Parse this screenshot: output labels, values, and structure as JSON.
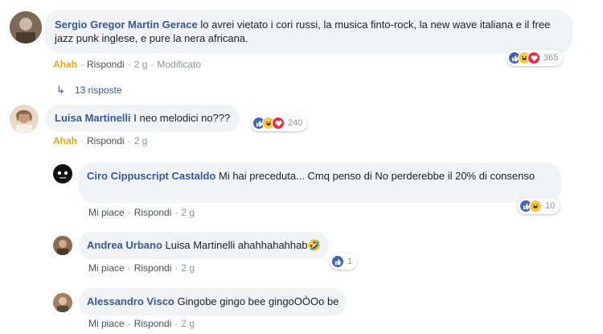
{
  "comments": [
    {
      "author": "Sergio Gregor Martin Gerace",
      "text": "lo avrei vietato i cori russi, la musica finto-rock, la new wave italiana e il free jazz punk inglese, e pure la nera africana.",
      "actions": {
        "react": "Ahah",
        "reply": "Rispondi",
        "time": "2 g",
        "edited": "Modificato"
      },
      "reaction_count": "365",
      "reactions": [
        "like-icon",
        "haha-icon",
        "love-icon"
      ]
    },
    {
      "author": "Luisa Martinelli",
      "text": "I neo melodici no???",
      "actions": {
        "react": "Ahah",
        "reply": "Rispondi",
        "time": "2 g"
      },
      "reaction_count": "240",
      "reactions": [
        "like-icon",
        "haha-icon",
        "love-icon"
      ]
    }
  ],
  "replies_link": {
    "label": "13 risposte"
  },
  "replies": [
    {
      "author": "Ciro Cippuscript Castaldo",
      "text": "Mi hai preceduta... Cmq penso di No perderebbe il 20% di consenso",
      "actions": {
        "like": "Mi piace",
        "reply": "Rispondi",
        "time": "2 g"
      },
      "reaction_count": "10",
      "reactions": [
        "like-icon",
        "haha-icon"
      ]
    },
    {
      "author": "Andrea Urbano",
      "text": "Luisa Martinelli ahahhahahhab",
      "emoji": "🤣",
      "actions": {
        "like": "Mi piace",
        "reply": "Rispondi",
        "time": "2 g"
      },
      "reaction_count": "1",
      "reactions": [
        "like-icon"
      ]
    },
    {
      "author": "Alessandro Visco",
      "text": "Gingobe gingo bee gingoOÒOo be",
      "actions": {
        "like": "Mi piace",
        "reply": "Rispondi",
        "time": "2 g"
      }
    }
  ],
  "colors": {
    "author": "#385898",
    "bubble": "#f2f3f5",
    "ahah": "#e6a817",
    "like": "#4267b2",
    "haha": "#f7c948",
    "love": "#f0284a"
  }
}
